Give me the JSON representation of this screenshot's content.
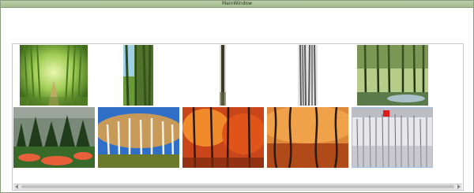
{
  "window": {
    "title": "MainWindow"
  },
  "gallery": {
    "row1": [
      {
        "name": "bamboo-forest-path",
        "palette": [
          "#cfe88a",
          "#6e9a2c",
          "#3c6a1a"
        ]
      },
      {
        "name": "bamboo-stalks-sky",
        "palette": [
          "#8cc0d8",
          "#5e8a36",
          "#2e4a1a"
        ]
      },
      {
        "name": "single-trunk-snow",
        "palette": [
          "#ffffff",
          "#4a4a3a",
          "#1e1e1a"
        ]
      },
      {
        "name": "birch-trunks-grey",
        "palette": [
          "#e8e8e8",
          "#9a9a9a",
          "#3c3c3c"
        ]
      },
      {
        "name": "pine-forest-river",
        "palette": [
          "#a8c07a",
          "#3e5a22",
          "#1c2a10"
        ]
      }
    ],
    "row2": [
      {
        "name": "conifers-with-flowers",
        "palette": [
          "#6a7a68",
          "#2a4a22",
          "#e0603a"
        ]
      },
      {
        "name": "autumn-birch-grove",
        "palette": [
          "#3a78d0",
          "#c89a5a",
          "#f0f0e8"
        ]
      },
      {
        "name": "red-maple-forest",
        "palette": [
          "#d04a18",
          "#f08a2a",
          "#3a2210"
        ]
      },
      {
        "name": "autumn-woodland-floor",
        "palette": [
          "#d8742a",
          "#8a3a10",
          "#2a1a0c"
        ]
      },
      {
        "name": "frosted-forest-red-marker",
        "palette": [
          "#e8e8ec",
          "#7a7a80",
          "#e01a1a"
        ]
      }
    ]
  }
}
